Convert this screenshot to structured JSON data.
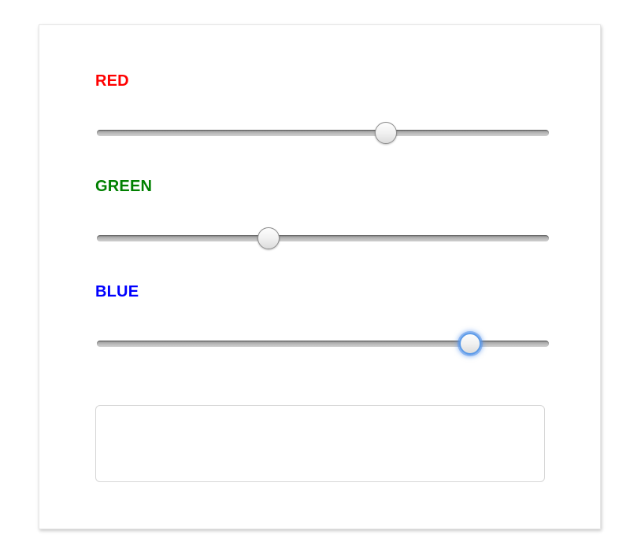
{
  "labels": {
    "red": "RED",
    "green": "GREEN",
    "blue": "BLUE"
  },
  "colors": {
    "red_label": "#ff0000",
    "green_label": "#008000",
    "blue_label": "#0000ff",
    "focus_ring": "#5b9ae8"
  },
  "sliders": {
    "red": {
      "fraction": 0.64
    },
    "green": {
      "fraction": 0.38
    },
    "blue": {
      "fraction": 0.825,
      "focused": true
    }
  },
  "output": {
    "value": ""
  }
}
